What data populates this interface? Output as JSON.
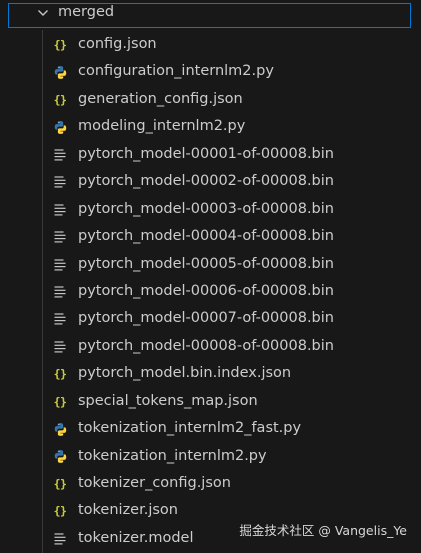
{
  "folder": {
    "name": "merged",
    "expanded": true,
    "focus_border_color": "#0078d4"
  },
  "files": [
    {
      "name": "config.json",
      "icon": "json-icon"
    },
    {
      "name": "configuration_internlm2.py",
      "icon": "python-icon"
    },
    {
      "name": "generation_config.json",
      "icon": "json-icon"
    },
    {
      "name": "modeling_internlm2.py",
      "icon": "python-icon"
    },
    {
      "name": "pytorch_model-00001-of-00008.bin",
      "icon": "file-lines-icon"
    },
    {
      "name": "pytorch_model-00002-of-00008.bin",
      "icon": "file-lines-icon"
    },
    {
      "name": "pytorch_model-00003-of-00008.bin",
      "icon": "file-lines-icon"
    },
    {
      "name": "pytorch_model-00004-of-00008.bin",
      "icon": "file-lines-icon"
    },
    {
      "name": "pytorch_model-00005-of-00008.bin",
      "icon": "file-lines-icon"
    },
    {
      "name": "pytorch_model-00006-of-00008.bin",
      "icon": "file-lines-icon"
    },
    {
      "name": "pytorch_model-00007-of-00008.bin",
      "icon": "file-lines-icon"
    },
    {
      "name": "pytorch_model-00008-of-00008.bin",
      "icon": "file-lines-icon"
    },
    {
      "name": "pytorch_model.bin.index.json",
      "icon": "json-icon"
    },
    {
      "name": "special_tokens_map.json",
      "icon": "json-icon"
    },
    {
      "name": "tokenization_internlm2_fast.py",
      "icon": "python-icon"
    },
    {
      "name": "tokenization_internlm2.py",
      "icon": "python-icon"
    },
    {
      "name": "tokenizer_config.json",
      "icon": "json-icon"
    },
    {
      "name": "tokenizer.json",
      "icon": "json-icon"
    },
    {
      "name": "tokenizer.model",
      "icon": "file-lines-icon"
    }
  ],
  "icon_colors": {
    "json": "#cbcb41",
    "python_blue": "#3776ab",
    "python_yellow": "#ffd43b",
    "file_lines": "#c5c5c5"
  },
  "watermark": "掘金技术社区 @ Vangelis_Ye"
}
